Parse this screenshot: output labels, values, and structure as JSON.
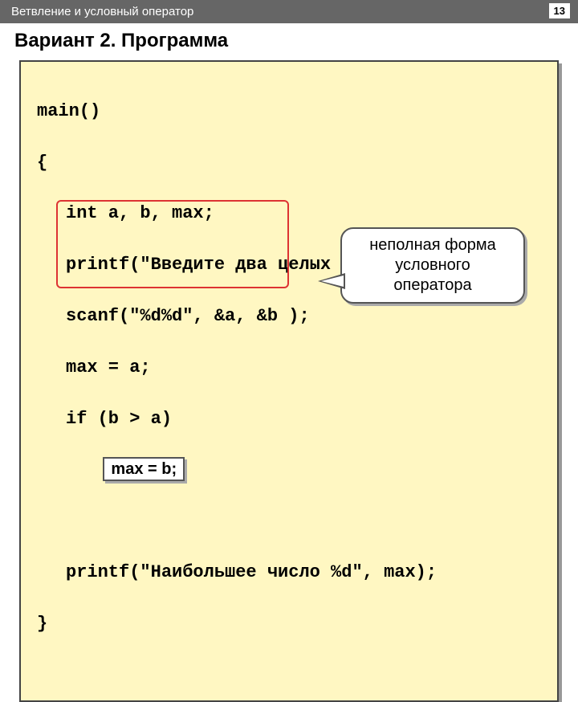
{
  "header": {
    "breadcrumb": "Ветвление и условный оператор",
    "page_number": "13"
  },
  "title": "Вариант 2. Программа",
  "code": {
    "line1": "main()",
    "line2": "{",
    "line3": "int a, b, max;",
    "line4": "printf(\"Введите два целых числа\\n\");",
    "line5": "scanf(\"%d%d\", &a, &b );",
    "line6": "max = a;",
    "line7": "if (b > a)",
    "line8_box": "max = b;",
    "line9": "printf(\"Наибольшее число %d\", max);",
    "line10": "}"
  },
  "callout": {
    "line1": "неполная форма",
    "line2": "условного",
    "line3": "оператора"
  }
}
